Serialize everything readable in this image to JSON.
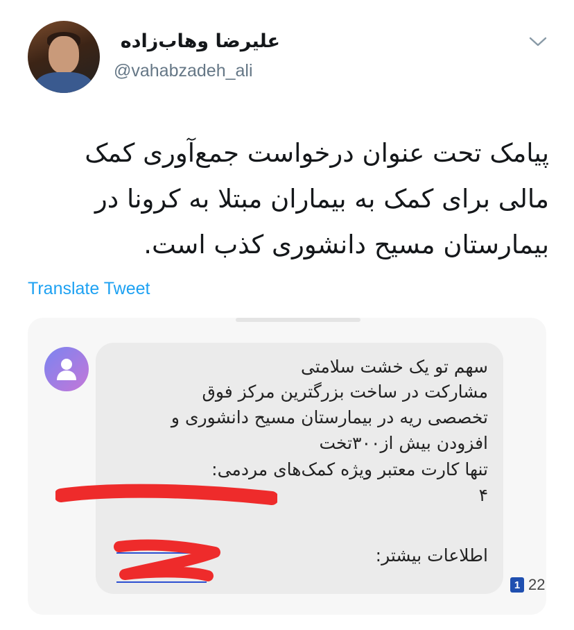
{
  "author": {
    "name": "علیرضا وهاب‌زاده",
    "handle": "@vahabzadeh_ali"
  },
  "tweet": {
    "lines": [
      "پیامک تحت عنوان درخواست جمع‌آوری کمک",
      "مالی برای کمک به بیماران مبتلا به کرونا در",
      "بیمارستان مسیح دانشوری کذب است."
    ],
    "translate_label": "Translate Tweet"
  },
  "sms": {
    "lines": [
      "سهم تو یک خشت سلامتی",
      "مشارکت در ساخت بزرگترین مرکز فوق",
      "تخصصی ریه در بیمارستان مسیح دانشوری و",
      "افزودن بیش از۳۰۰تخت",
      "تنها کارت معتبر ویژه کمک‌های مردمی:",
      "۴",
      "اطلاعات بیشتر:"
    ],
    "sim_slot": "1",
    "count": "22"
  },
  "colors": {
    "link": "#1da1f2",
    "secondary_text": "#657786",
    "redaction": "#ee2b2b"
  },
  "icons": {
    "menu": "chevron-down-icon",
    "contact": "person-icon"
  }
}
